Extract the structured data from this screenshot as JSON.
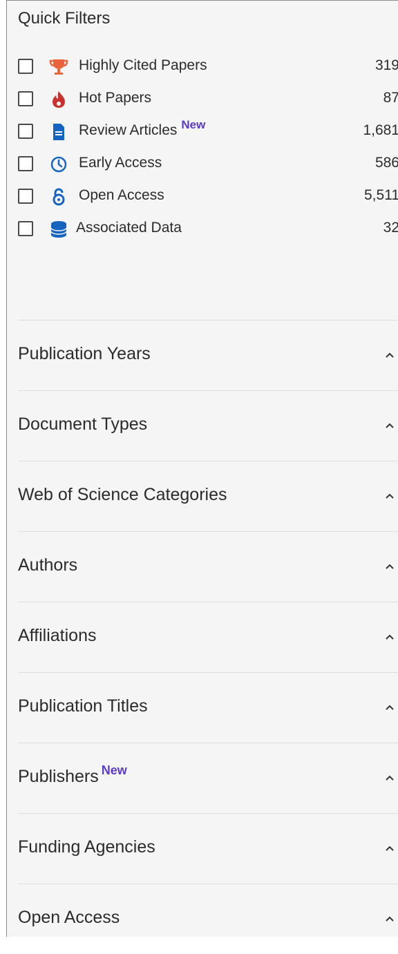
{
  "quick_filters": {
    "title": "Quick Filters",
    "items": [
      {
        "label": "Highly Cited Papers",
        "count": "319",
        "icon": "trophy-icon",
        "new": "",
        "color": "#e8643c"
      },
      {
        "label": "Hot Papers",
        "count": "87",
        "icon": "flame-icon",
        "new": "",
        "color": "#c7332e"
      },
      {
        "label": "Review Articles",
        "count": "1,681",
        "icon": "document-icon",
        "new": "New",
        "color": "#1565c0"
      },
      {
        "label": "Early Access",
        "count": "586",
        "icon": "clock-icon",
        "new": "",
        "color": "#1565c0"
      },
      {
        "label": "Open Access",
        "count": "5,511",
        "icon": "open-lock-icon",
        "new": "",
        "color": "#1565c0"
      },
      {
        "label": "Associated Data",
        "count": "32",
        "icon": "database-icon",
        "new": "",
        "color": "#1565c0"
      }
    ]
  },
  "sections": [
    {
      "label": "Publication Years",
      "new": ""
    },
    {
      "label": "Document Types",
      "new": ""
    },
    {
      "label": "Web of Science Categories",
      "new": ""
    },
    {
      "label": "Authors",
      "new": ""
    },
    {
      "label": "Affiliations",
      "new": ""
    },
    {
      "label": "Publication Titles",
      "new": ""
    },
    {
      "label": "Publishers",
      "new": "New"
    },
    {
      "label": "Funding Agencies",
      "new": ""
    },
    {
      "label": "Open Access",
      "new": ""
    }
  ],
  "colors": {
    "new_badge": "#5b3bc9",
    "panel_bg": "#f5f5f5"
  }
}
